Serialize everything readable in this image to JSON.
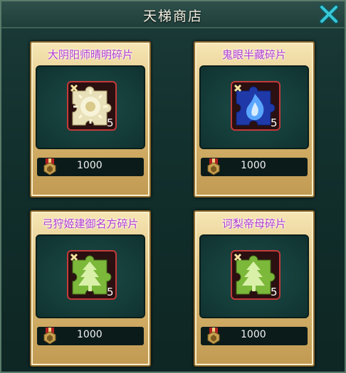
{
  "header": {
    "title": "天梯商店",
    "close_icon": "close-icon"
  },
  "colors": {
    "title": "#f3efe2",
    "card_title": "#b13bd1",
    "close_x": "#39c7d6",
    "gold_frame": "#d8b670",
    "teal_panel": "#1b3b38"
  },
  "items": [
    {
      "name": "大阴阳师晴明碎片",
      "price": "1000",
      "count": "5",
      "icon": "gold-puzzle-icon"
    },
    {
      "name": "鬼眼半藏碎片",
      "price": "1000",
      "count": "5",
      "icon": "blue-flame-puzzle-icon"
    },
    {
      "name": "弓狩姬建御名方碎片",
      "price": "1000",
      "count": "5",
      "icon": "green-tree-puzzle-icon"
    },
    {
      "name": "诃梨帝母碎片",
      "price": "1000",
      "count": "5",
      "icon": "green-tree-puzzle-icon"
    }
  ]
}
